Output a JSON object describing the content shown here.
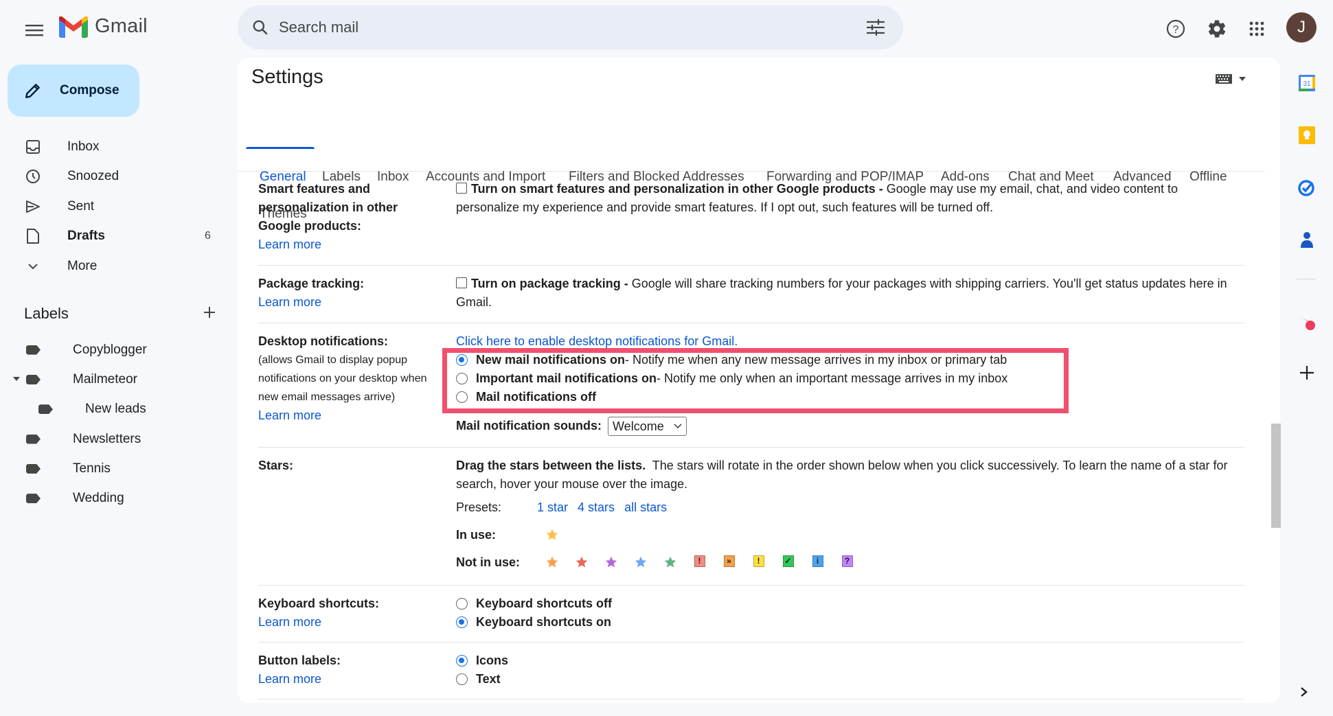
{
  "header": {
    "app_name": "Gmail",
    "search_placeholder": "Search mail",
    "avatar_initial": "J",
    "icons": [
      "menu-icon",
      "search-icon",
      "search-options-icon",
      "help-icon",
      "settings-icon",
      "apps-icon"
    ]
  },
  "sidebar": {
    "compose_label": "Compose",
    "nav": [
      {
        "label": "Inbox",
        "icon": "inbox-icon"
      },
      {
        "label": "Snoozed",
        "icon": "clock-icon"
      },
      {
        "label": "Sent",
        "icon": "send-icon"
      },
      {
        "label": "Drafts",
        "icon": "draft-icon",
        "count": "6",
        "bold": true
      },
      {
        "label": "More",
        "icon": "chevron-down-icon"
      }
    ],
    "labels_title": "Labels",
    "labels": [
      {
        "label": "Copyblogger"
      },
      {
        "label": "Mailmeteor",
        "expanded": true
      },
      {
        "label": "New leads",
        "child": true
      },
      {
        "label": "Newsletters"
      },
      {
        "label": "Tennis"
      },
      {
        "label": "Wedding"
      }
    ]
  },
  "settings": {
    "title": "Settings",
    "tabs": [
      "General",
      "Labels",
      "Inbox",
      "Accounts and Import",
      "Filters and Blocked Addresses",
      "Forwarding and POP/IMAP",
      "Add-ons",
      "Chat and Meet",
      "Advanced",
      "Offline",
      "Themes"
    ],
    "active_tab": "General",
    "learn_more": "Learn more",
    "smart": {
      "label": "Smart features and personalization in other Google products:",
      "option_bold": "Turn on smart features and personalization in other Google products -",
      "option_text": " Google may use my email, chat, and video content to personalize my experience and provide smart features. If I opt out, such features will be turned off."
    },
    "package": {
      "label": "Package tracking:",
      "option_bold": "Turn on package tracking -",
      "option_text": " Google will share tracking numbers for your packages with shipping carriers. You'll get status updates here in Gmail."
    },
    "desktop": {
      "label": "Desktop notifications:",
      "sub": "(allows Gmail to display popup notifications on your desktop when new email messages arrive)",
      "enable_link": "Click here to enable desktop notifications for Gmail.",
      "options": [
        {
          "bold": "New mail notifications on",
          "text": " - Notify me when any new message arrives in my inbox or primary tab",
          "selected": true
        },
        {
          "bold": "Important mail notifications on",
          "text": " - Notify me only when an important message arrives in my inbox",
          "selected": false
        },
        {
          "bold": "Mail notifications off",
          "text": "",
          "selected": false
        }
      ],
      "sound_label": "Mail notification sounds:",
      "sound_value": "Welcome",
      "highlight_color": "#f0506e"
    },
    "stars": {
      "label": "Stars:",
      "desc_bold": "Drag the stars between the lists.",
      "desc_text": "  The stars will rotate in the order shown below when you click successively. To learn the name of a star for search, hover your mouse over the image.",
      "presets_label": "Presets:",
      "presets": [
        "1 star",
        "4 stars",
        "all stars"
      ],
      "in_use_label": "In use:",
      "not_in_use_label": "Not in use:",
      "in_use": [
        {
          "name": "yellow-star",
          "color": "#f7c04a"
        }
      ],
      "not_in_use": [
        {
          "name": "orange-star",
          "type": "star",
          "color": "#f6a04d"
        },
        {
          "name": "red-star",
          "type": "star",
          "color": "#e8685a"
        },
        {
          "name": "purple-star",
          "type": "star",
          "color": "#b36ad8"
        },
        {
          "name": "blue-star",
          "type": "star",
          "color": "#72a6f5"
        },
        {
          "name": "green-star",
          "type": "star",
          "color": "#5fb37f"
        },
        {
          "name": "red-bang",
          "type": "box",
          "color": "#f28b82",
          "glyph": "!"
        },
        {
          "name": "orange-guillemet",
          "type": "box",
          "color": "#f6a04d",
          "glyph": "»"
        },
        {
          "name": "yellow-bang",
          "type": "box",
          "color": "#fde047",
          "glyph": "!"
        },
        {
          "name": "green-check",
          "type": "box",
          "color": "#34c759",
          "glyph": "✓"
        },
        {
          "name": "blue-info",
          "type": "box",
          "color": "#4da3f0",
          "glyph": "i"
        },
        {
          "name": "purple-question",
          "type": "box",
          "color": "#c084fc",
          "glyph": "?"
        }
      ]
    },
    "keyboard": {
      "label": "Keyboard shortcuts:",
      "options": [
        {
          "label": "Keyboard shortcuts off",
          "selected": false
        },
        {
          "label": "Keyboard shortcuts on",
          "selected": true
        }
      ]
    },
    "buttons": {
      "label": "Button labels:",
      "options": [
        {
          "label": "Icons",
          "selected": true
        },
        {
          "label": "Text",
          "selected": false
        }
      ]
    }
  },
  "rail": [
    "calendar-icon",
    "keep-icon",
    "tasks-icon",
    "contacts-icon",
    "mailmeteor-icon",
    "add-addon-icon"
  ]
}
